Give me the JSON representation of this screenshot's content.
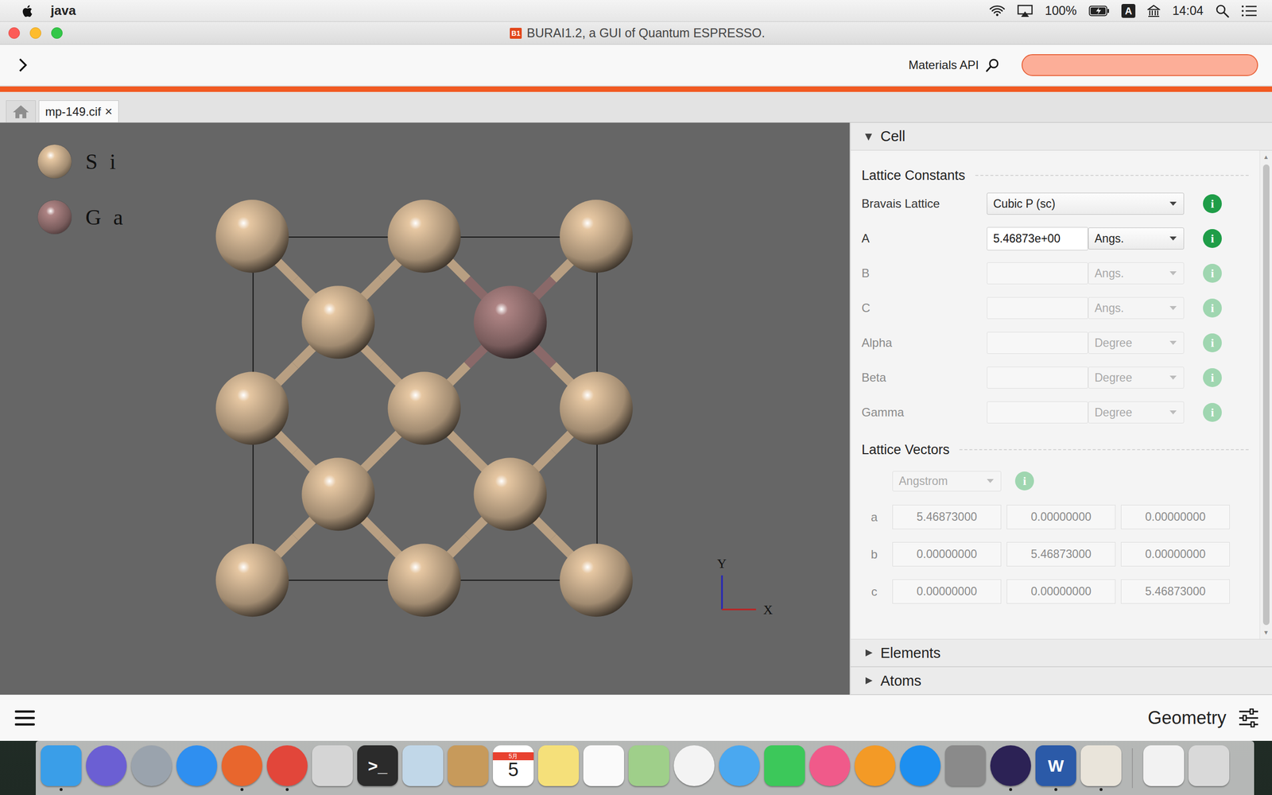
{
  "menubar": {
    "app": "java",
    "battery": "100%",
    "input": "A",
    "clock": "14:04"
  },
  "window": {
    "title": "BURAI1.2, a GUI of Quantum ESPRESSO.",
    "badge": "B1"
  },
  "toolbar": {
    "search_label": "Materials API",
    "search_value": ""
  },
  "tabs": [
    {
      "label": "mp-149.cif",
      "close": "×",
      "selected": true
    }
  ],
  "viewer": {
    "legend": [
      {
        "element": "Si",
        "color": "#e6c7a2"
      },
      {
        "element": "Ga",
        "color": "#ad8383"
      }
    ],
    "atoms": [
      "Si",
      "Si",
      "Si",
      "Si",
      "Si",
      "Si",
      "Si",
      "Si",
      "Si",
      "Si",
      "Ga",
      "Si",
      "Si"
    ],
    "axes": {
      "x": "X",
      "y": "Y"
    }
  },
  "panel": {
    "info_glyph": "i",
    "sections": [
      {
        "title": "Cell",
        "expanded": true
      },
      {
        "title": "Elements",
        "expanded": false
      },
      {
        "title": "Atoms",
        "expanded": false
      }
    ],
    "lattice_constants": {
      "heading": "Lattice Constants",
      "rows": [
        {
          "label": "Bravais Lattice",
          "kind": "select",
          "value": "Cubic P (sc)",
          "unit": "",
          "disabled": false
        },
        {
          "label": "A",
          "kind": "field",
          "value": "5.46873e+00",
          "unit": "Angs.",
          "disabled": false
        },
        {
          "label": "B",
          "kind": "field",
          "value": "",
          "unit": "Angs.",
          "disabled": true
        },
        {
          "label": "C",
          "kind": "field",
          "value": "",
          "unit": "Angs.",
          "disabled": true
        },
        {
          "label": "Alpha",
          "kind": "field",
          "value": "",
          "unit": "Degree",
          "disabled": true
        },
        {
          "label": "Beta",
          "kind": "field",
          "value": "",
          "unit": "Degree",
          "disabled": true
        },
        {
          "label": "Gamma",
          "kind": "field",
          "value": "",
          "unit": "Degree",
          "disabled": true
        }
      ]
    },
    "lattice_vectors": {
      "heading": "Lattice Vectors",
      "unit": "Angstrom",
      "unit_disabled": true,
      "rows": [
        {
          "label": "a",
          "values": [
            "5.46873000",
            "0.00000000",
            "0.00000000"
          ],
          "disabled": true
        },
        {
          "label": "b",
          "values": [
            "0.00000000",
            "5.46873000",
            "0.00000000"
          ],
          "disabled": true
        },
        {
          "label": "c",
          "values": [
            "0.00000000",
            "0.00000000",
            "5.46873000"
          ],
          "disabled": true
        }
      ]
    }
  },
  "bottom_bar": {
    "mode": "Geometry"
  },
  "dock": [
    {
      "kind": "square",
      "color": "#3a9ee8",
      "running": true,
      "text": "",
      "caption": ""
    },
    {
      "kind": "circle",
      "color": "#6b5fd3",
      "running": false,
      "text": "",
      "caption": ""
    },
    {
      "kind": "circle",
      "color": "#9aa3ad",
      "running": false,
      "text": "",
      "caption": ""
    },
    {
      "kind": "circle",
      "color": "#2f8ff0",
      "running": false,
      "text": "",
      "caption": ""
    },
    {
      "kind": "circle",
      "color": "#e8662d",
      "running": true,
      "text": "",
      "caption": ""
    },
    {
      "kind": "circle",
      "color": "#e2463a",
      "running": true,
      "text": "",
      "caption": ""
    },
    {
      "kind": "square",
      "color": "#d5d5d5",
      "running": false,
      "text": "",
      "caption": ""
    },
    {
      "kind": "square",
      "color": "#2b2b2b",
      "running": false,
      "text": ">_",
      "caption": ""
    },
    {
      "kind": "square",
      "color": "#c1d7e8",
      "running": false,
      "text": "",
      "caption": ""
    },
    {
      "kind": "square",
      "color": "#c79a5b",
      "running": false,
      "text": "",
      "caption": ""
    },
    {
      "kind": "square",
      "color": "#ffffff",
      "running": false,
      "text": "5",
      "caption": "5月"
    },
    {
      "kind": "square",
      "color": "#f5e07a",
      "running": false,
      "text": "",
      "caption": ""
    },
    {
      "kind": "square",
      "color": "#fafafa",
      "running": false,
      "text": "",
      "caption": ""
    },
    {
      "kind": "square",
      "color": "#9fcf8a",
      "running": false,
      "text": "",
      "caption": ""
    },
    {
      "kind": "circle",
      "color": "#f3f3f3",
      "running": false,
      "text": "",
      "caption": ""
    },
    {
      "kind": "circle",
      "color": "#4aa8f0",
      "running": false,
      "text": "",
      "caption": ""
    },
    {
      "kind": "square",
      "color": "#3cc85a",
      "running": false,
      "text": "",
      "caption": ""
    },
    {
      "kind": "circle",
      "color": "#f05a8a",
      "running": false,
      "text": "",
      "caption": ""
    },
    {
      "kind": "circle",
      "color": "#f39a26",
      "running": false,
      "text": "",
      "caption": ""
    },
    {
      "kind": "circle",
      "color": "#1d8ff0",
      "running": false,
      "text": "",
      "caption": ""
    },
    {
      "kind": "square",
      "color": "#8a8a8a",
      "running": false,
      "text": "",
      "caption": ""
    },
    {
      "kind": "circle",
      "color": "#2c2255",
      "running": true,
      "text": "",
      "caption": ""
    },
    {
      "kind": "square",
      "color": "#2b5aa8",
      "running": true,
      "text": "W",
      "caption": ""
    },
    {
      "kind": "square",
      "color": "#e9e4da",
      "running": true,
      "text": "",
      "caption": ""
    },
    {
      "kind": "separator",
      "color": "#9a9a9a",
      "running": false,
      "text": "",
      "caption": ""
    },
    {
      "kind": "square",
      "color": "#f2f2f2",
      "running": false,
      "text": "",
      "caption": ""
    },
    {
      "kind": "square",
      "color": "#d9d9d9",
      "running": false,
      "text": "",
      "caption": ""
    }
  ]
}
